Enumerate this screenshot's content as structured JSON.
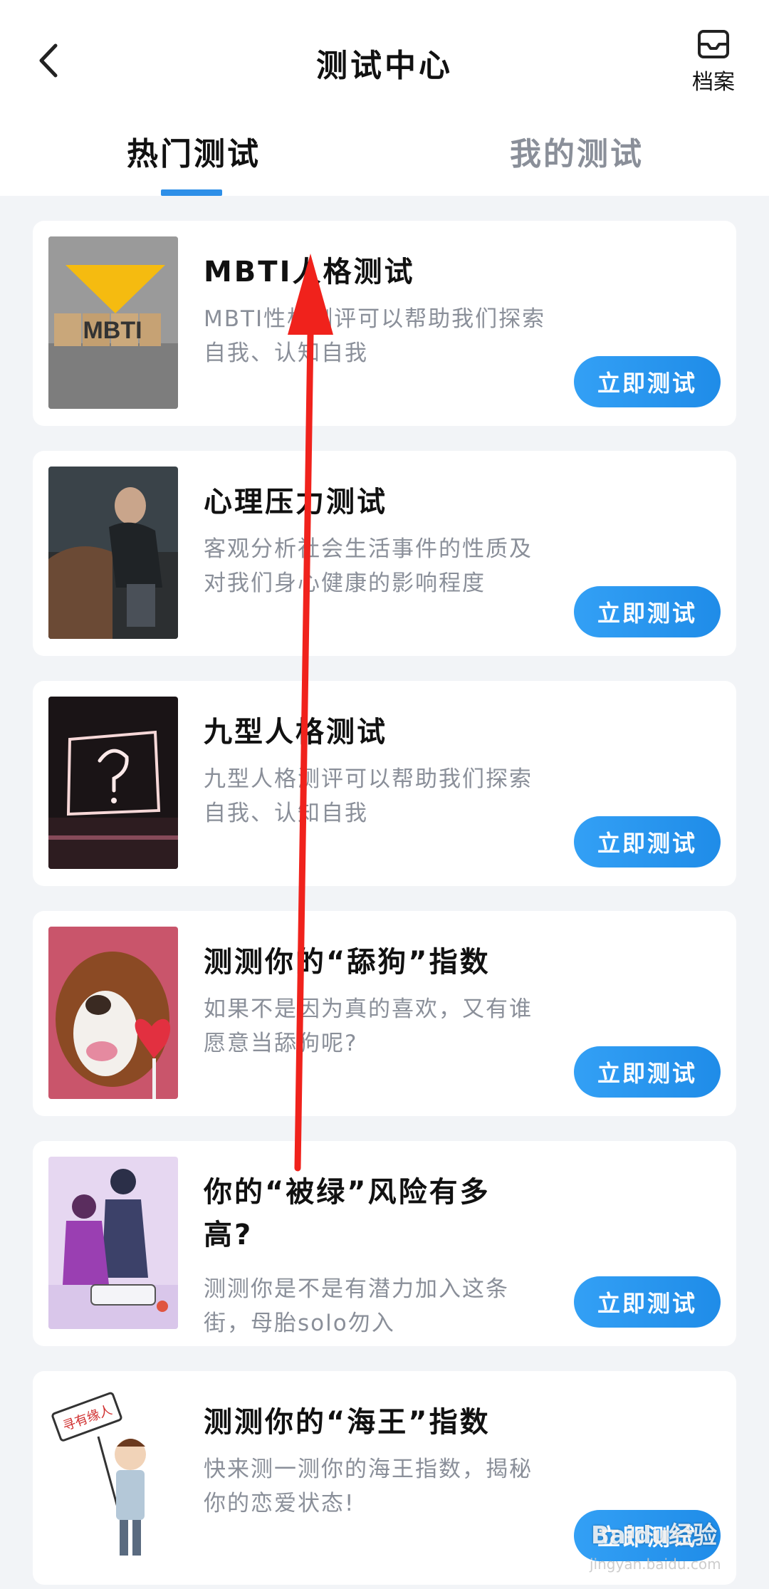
{
  "header": {
    "title": "测试中心",
    "archive_label": "档案",
    "back_icon": "chevron-left-icon",
    "archive_icon": "inbox-icon"
  },
  "tabs": [
    {
      "label": "热门测试",
      "active": true
    },
    {
      "label": "我的测试",
      "active": false
    }
  ],
  "colors": {
    "accent": "#2e8fe8",
    "button": "#1f8ce8",
    "annotation_arrow": "#f0221c"
  },
  "cards": [
    {
      "title": "MBTI人格测试",
      "desc1": "MBTI性格测评可以帮助我们探索",
      "desc2": "自我、认知自我",
      "button": "立即测试",
      "thumb_label": "MBTI"
    },
    {
      "title": "心理压力测试",
      "desc1": "客观分析社会生活事件的性质及",
      "desc2": "对我们身心健康的影响程度",
      "button": "立即测试"
    },
    {
      "title": "九型人格测试",
      "desc1": "九型人格测评可以帮助我们探索",
      "desc2": "自我、认知自我",
      "button": "立即测试"
    },
    {
      "title": "测测你的“舔狗”指数",
      "desc1": "如果不是因为真的喜欢，又有谁",
      "desc2": "愿意当舔狗呢?",
      "button": "立即测试"
    },
    {
      "title1": "你的“被绿”风险有多",
      "title2": "高?",
      "desc1": "测测你是不是有潜力加入这条",
      "desc2": "街，母胎solo勿入",
      "button": "立即测试"
    },
    {
      "title": "测测你的“海王”指数",
      "desc1": "快来测一测你的海王指数，揭秘",
      "desc2": "你的恋爱状态!",
      "button": "立即测试",
      "sign_label": "寻有缘人"
    }
  ],
  "watermark": {
    "brand": "Baidu经验",
    "url": "jingyan.baidu.com"
  }
}
